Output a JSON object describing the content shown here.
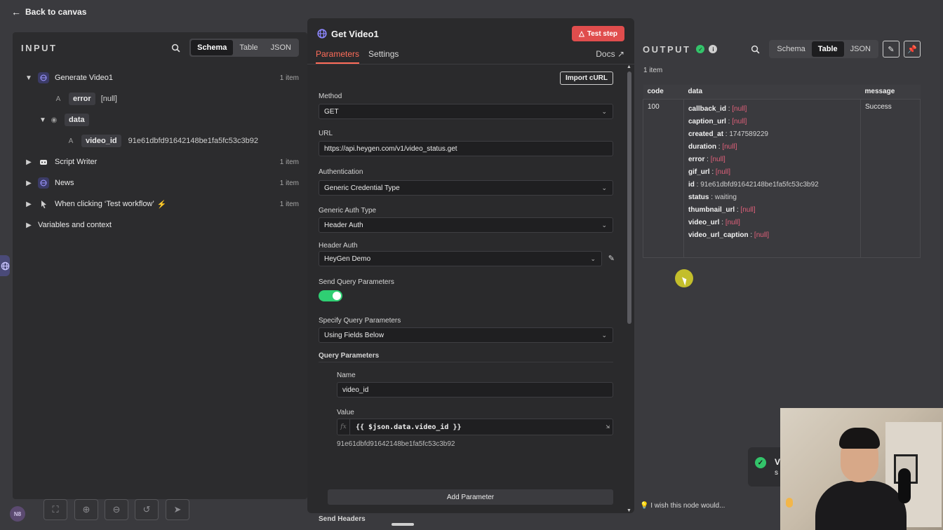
{
  "top": {
    "back_label": "Back to canvas"
  },
  "input": {
    "title": "INPUT",
    "views": [
      "Schema",
      "Table",
      "JSON"
    ],
    "active_view": "Schema",
    "tree": {
      "node1": {
        "name": "Generate Video1",
        "count": "1 item"
      },
      "error": {
        "type": "A",
        "key": "error",
        "value": "[null]"
      },
      "data": {
        "key": "data"
      },
      "video_id": {
        "type": "A",
        "key": "video_id",
        "value": "91e61dbfd91642148be1fa5fc53c3b92"
      },
      "node2": {
        "name": "Script Writer",
        "count": "1 item"
      },
      "node3": {
        "name": "News",
        "count": "1 item"
      },
      "node4": {
        "name": "When clicking ‘Test workflow’",
        "count": "1 item"
      },
      "vars": {
        "name": "Variables and context"
      }
    }
  },
  "modal": {
    "title": "Get Video1",
    "test_step": "Test step",
    "tabs": [
      "Parameters",
      "Settings"
    ],
    "docs": "Docs",
    "import_curl": "Import cURL",
    "method": {
      "label": "Method",
      "value": "GET"
    },
    "url": {
      "label": "URL",
      "value": "https://api.heygen.com/v1/video_status.get"
    },
    "authentication": {
      "label": "Authentication",
      "value": "Generic Credential Type"
    },
    "generic_auth_type": {
      "label": "Generic Auth Type",
      "value": "Header Auth"
    },
    "header_auth": {
      "label": "Header Auth",
      "value": "HeyGen Demo"
    },
    "send_query": {
      "label": "Send Query Parameters",
      "on": true
    },
    "specify_query": {
      "label": "Specify Query Parameters",
      "value": "Using Fields Below"
    },
    "query_params": {
      "label": "Query Parameters",
      "name_label": "Name",
      "name_value": "video_id",
      "value_label": "Value",
      "value_expr": "{{ $json.data.video_id }}",
      "value_preview": "91e61dbfd91642148be1fa5fc53c3b92"
    },
    "add_parameter": "Add Parameter",
    "send_headers": {
      "label": "Send Headers"
    }
  },
  "output": {
    "title": "OUTPUT",
    "views": [
      "Schema",
      "Table",
      "JSON"
    ],
    "active_view": "Table",
    "items": "1 item",
    "columns": [
      "code",
      "data",
      "message"
    ],
    "row": {
      "code": "100",
      "message": "Success",
      "fields": [
        {
          "key": "callback_id",
          "value": "[null]",
          "null": true
        },
        {
          "key": "caption_url",
          "value": "[null]",
          "null": true
        },
        {
          "key": "created_at",
          "value": "1747589229",
          "null": false
        },
        {
          "key": "duration",
          "value": "[null]",
          "null": true
        },
        {
          "key": "error",
          "value": "[null]",
          "null": true
        },
        {
          "key": "gif_url",
          "value": "[null]",
          "null": true
        },
        {
          "key": "id",
          "value": "91e61dbfd91642148be1fa5fc53c3b92",
          "null": false
        },
        {
          "key": "status",
          "value": "waiting",
          "null": false
        },
        {
          "key": "thumbnail_url",
          "value": "[null]",
          "null": true
        },
        {
          "key": "video_url",
          "value": "[null]",
          "null": true
        },
        {
          "key": "video_url_caption",
          "value": "[null]",
          "null": true
        }
      ]
    },
    "feedback": "I wish this node would..."
  },
  "toast": {
    "text": "V\ns"
  },
  "colors": {
    "accent": "#ff6d5a",
    "success": "#33c46a",
    "null": "#e0607a",
    "test_button": "#e04d4d"
  }
}
